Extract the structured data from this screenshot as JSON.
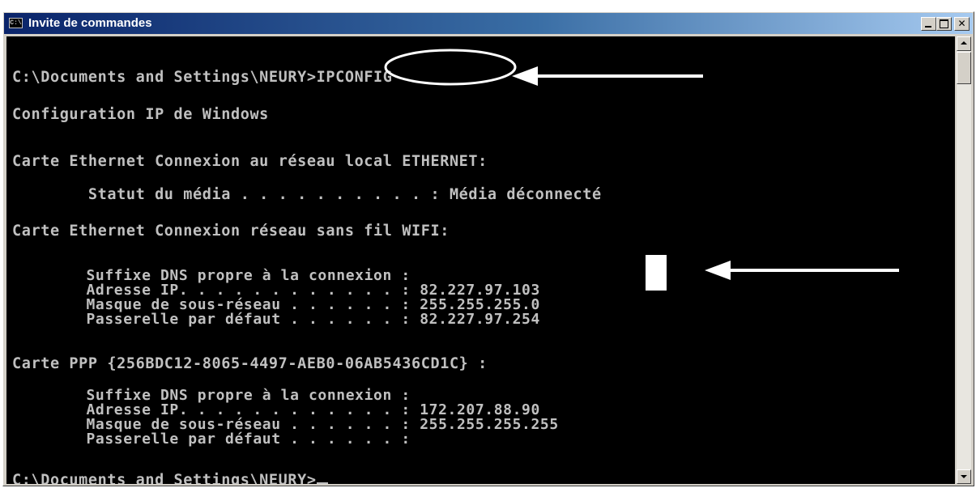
{
  "window": {
    "title": "Invite de commandes",
    "icon": "console-icon",
    "icon_glyph": "C:\\",
    "buttons": {
      "minimize": "minimize-icon",
      "maximize": "maximize-icon",
      "close": "✕"
    }
  },
  "console": {
    "prompt_path": "C:\\Documents and Settings\\NEURY>",
    "command": "IPCONFIG",
    "lines": {
      "config_title": "Configuration IP de Windows",
      "adapter_eth": "Carte Ethernet Connexion au réseau local ETHERNET:",
      "eth_status": "        Statut du média . . . . . . . . . . : Média déconnecté",
      "adapter_wifi": "Carte Ethernet Connexion réseau sans fil WIFI:",
      "wifi_dns": "        Suffixe DNS propre à la connexion :",
      "wifi_ip": "        Adresse IP. . . . . . . . . . . . : 82.227.97.103",
      "wifi_mask": "        Masque de sous-réseau . . . . . . : 255.255.255.0",
      "wifi_gw": "        Passerelle par défaut . . . . . . : 82.227.97.254",
      "adapter_ppp": "Carte PPP {256BDC12-8065-4497-AEB0-06AB5436CD1C} :",
      "ppp_dns": "        Suffixe DNS propre à la connexion :",
      "ppp_ip": "        Adresse IP. . . . . . . . . . . . : 172.207.88.90",
      "ppp_mask": "        Masque de sous-réseau . . . . . . : 255.255.255.255",
      "ppp_gw": "        Passerelle par défaut . . . . . . :",
      "final_prompt": "C:\\Documents and Settings\\NEURY>"
    }
  },
  "colors": {
    "console_bg": "#000000",
    "console_text": "#c0c0c0",
    "titlebar_start": "#0a246a",
    "titlebar_end": "#a6caf0",
    "annotation": "#ffffff"
  }
}
